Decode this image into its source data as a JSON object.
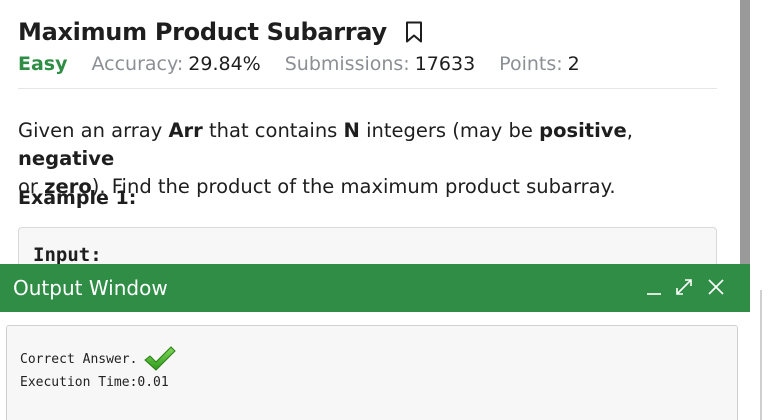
{
  "problem": {
    "title": "Maximum Product Subarray",
    "difficulty": "Easy",
    "accuracy_label": "Accuracy:",
    "accuracy_value": "29.84%",
    "submissions_label": "Submissions:",
    "submissions_value": "17633",
    "points_label": "Points:",
    "points_value": "2",
    "statement": {
      "part1": "Given an array ",
      "arr": "Arr",
      "part2": " that contains ",
      "n": "N",
      "part3": " integers (may be ",
      "positive": "positive",
      "comma": ", ",
      "negative": "negative",
      "part4": " or ",
      "zero": "zero",
      "part5": "). Find the product of the maximum product subarray."
    },
    "example_heading": "Example 1:",
    "example_input_label": "Input:"
  },
  "output_window": {
    "title": "Output Window",
    "minimize_glyph": "_",
    "expand_glyph": "⤢",
    "close_glyph": "✕",
    "result_text": "Correct Answer.",
    "execution_text": "Execution Time:0.01"
  },
  "colors": {
    "accent_green": "#2f8d46",
    "check_green": "#4caf2a"
  },
  "icons": {
    "bookmark": "bookmark-icon",
    "check": "check-icon"
  }
}
